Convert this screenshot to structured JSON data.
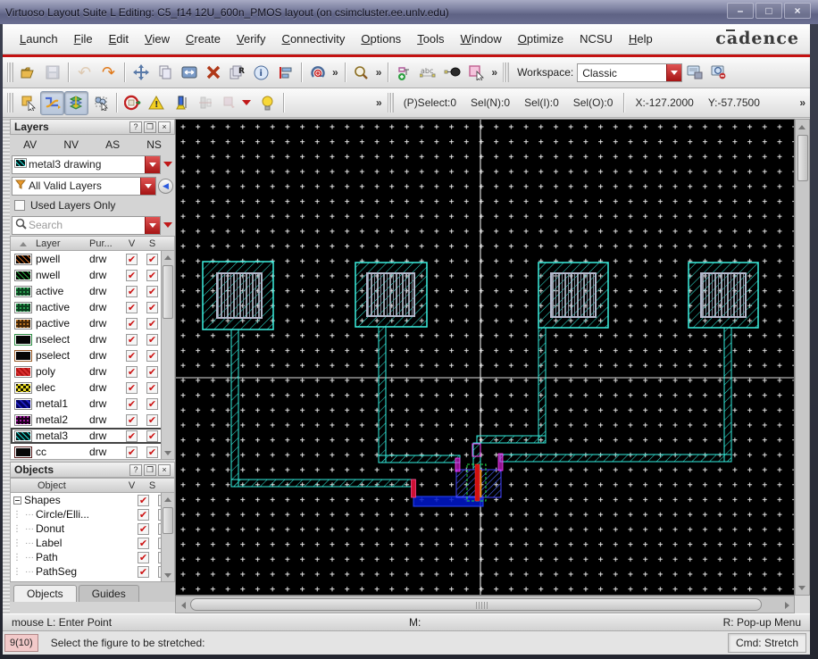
{
  "window": {
    "title": "Virtuoso Layout Suite L Editing: C5_f14 12U_600n_PMOS layout (on csimcluster.ee.unlv.edu)"
  },
  "brand": "cadence",
  "icons": {
    "minimize": "–",
    "maximize": "□",
    "close": "×",
    "chevron_more": "»",
    "check": "✔",
    "undo": "↶",
    "redo": "↷",
    "collapse_left": "◀◀",
    "question": "?",
    "restore": "❐",
    "x": "×",
    "search": "🔍"
  },
  "menu": {
    "items": [
      "Launch",
      "File",
      "Edit",
      "View",
      "Create",
      "Verify",
      "Connectivity",
      "Options",
      "Tools",
      "Window",
      "Optimize",
      "NCSU",
      "Help"
    ]
  },
  "toolbar": {
    "workspace_label": "Workspace:",
    "workspace_value": "Classic"
  },
  "toolbar2": {
    "pselect": "(P)Select:0",
    "sel_n": "Sel(N):0",
    "sel_i": "Sel(I):0",
    "sel_o": "Sel(O):0",
    "x": "X:-127.2000",
    "y": "Y:-57.7500"
  },
  "layers_panel": {
    "title": "Layers",
    "visibility_buttons": [
      "AV",
      "NV",
      "AS",
      "NS"
    ],
    "active_layer": "metal3 drawing",
    "filter_value": "All Valid Layers",
    "used_layers_only": "Used Layers Only",
    "search_placeholder": "Search",
    "table": {
      "headers": [
        "Layer",
        "Pur...",
        "V",
        "S"
      ],
      "rows": [
        {
          "name": "pwell",
          "purpose": "drw"
        },
        {
          "name": "nwell",
          "purpose": "drw"
        },
        {
          "name": "active",
          "purpose": "drw"
        },
        {
          "name": "nactive",
          "purpose": "drw"
        },
        {
          "name": "pactive",
          "purpose": "drw"
        },
        {
          "name": "nselect",
          "purpose": "drw"
        },
        {
          "name": "pselect",
          "purpose": "drw"
        },
        {
          "name": "poly",
          "purpose": "drw"
        },
        {
          "name": "elec",
          "purpose": "drw"
        },
        {
          "name": "metal1",
          "purpose": "drw"
        },
        {
          "name": "metal2",
          "purpose": "drw"
        },
        {
          "name": "metal3",
          "purpose": "drw"
        },
        {
          "name": "cc",
          "purpose": "drw"
        }
      ],
      "selected_row": "metal3"
    }
  },
  "objects_panel": {
    "title": "Objects",
    "headers": [
      "Object",
      "V",
      "S"
    ],
    "tree": [
      {
        "label": "Shapes"
      },
      {
        "label": "Circle/Elli..."
      },
      {
        "label": "Donut"
      },
      {
        "label": "Label"
      },
      {
        "label": "Path"
      },
      {
        "label": "PathSeg"
      }
    ],
    "tabs": [
      "Objects",
      "Guides"
    ]
  },
  "statusbar": {
    "left": "mouse L: Enter Point",
    "middle": "M:",
    "right": "R: Pop-up Menu"
  },
  "commandbar": {
    "counter": "9(10)",
    "prompt": "Select the figure to be stretched:",
    "cmd": "Cmd: Stretch"
  },
  "colors": {
    "metal3_cyan": "#30e8d8",
    "metal1_blue": "#1a22d8",
    "metal2_magenta": "#ee22ee",
    "poly_red": "#d01010",
    "active_green": "#22dd44",
    "grid_white": "#ffffff",
    "canvas_bg": "#000000",
    "accent_red": "#c41212",
    "titlebar": "#6b6f92"
  }
}
